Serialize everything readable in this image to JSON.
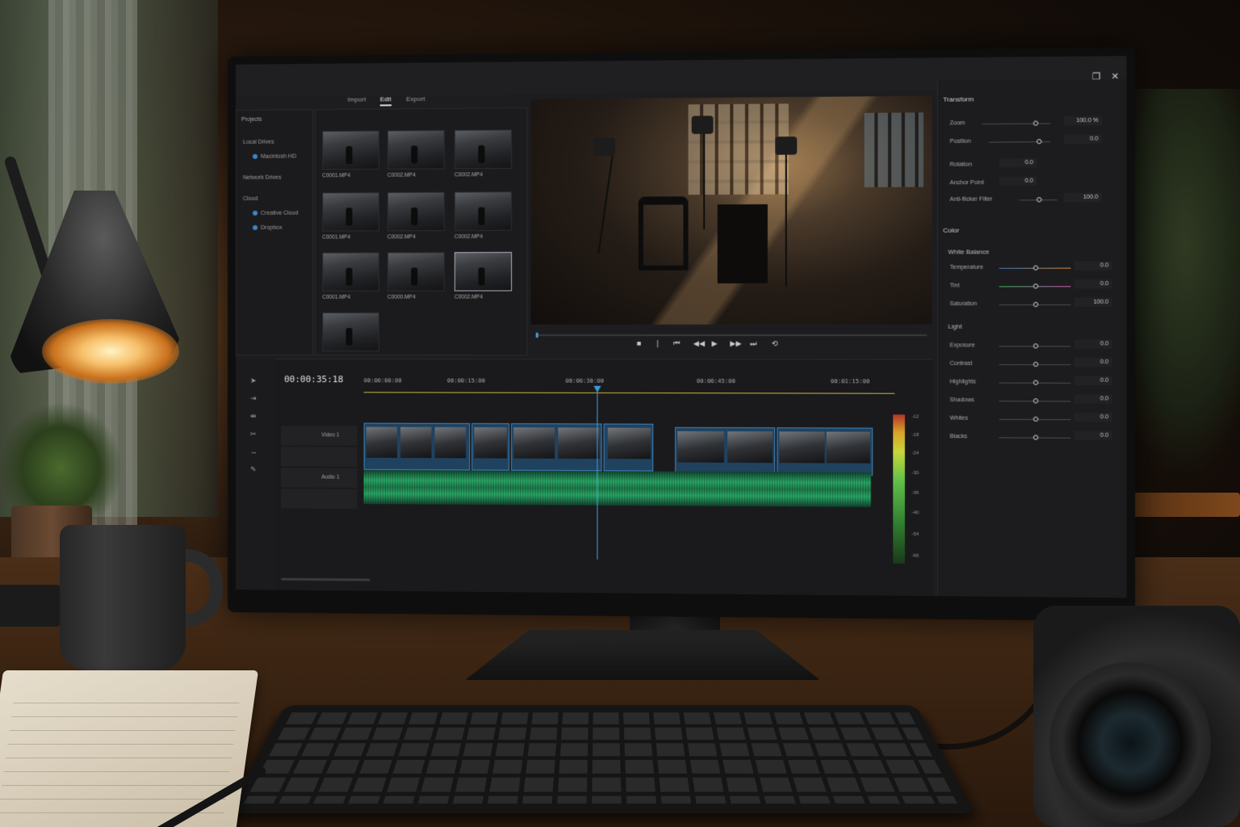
{
  "app": {
    "tabs": [
      "Import",
      "Edit",
      "Export"
    ],
    "active_tab": "Edit",
    "window_close": "✕",
    "window_restore": "❐"
  },
  "sources": {
    "title": "Projects",
    "sections": [
      {
        "label": "Local Drives",
        "items": [
          "Macintosh HD"
        ]
      },
      {
        "label": "Network Drives",
        "items": []
      },
      {
        "label": "Cloud",
        "items": [
          "Creative Cloud",
          "Dropbox"
        ]
      }
    ]
  },
  "media_bin": {
    "clips": [
      "C0001.MP4",
      "C0002.MP4",
      "C0002.MP4",
      "C0001.MP4",
      "C0002.MP4",
      "C0002.MP4",
      "C0001.MP4",
      "C0000.MP4",
      "C0002.MP4"
    ]
  },
  "timeline": {
    "timecode": "00:00:35:18",
    "ruler": [
      "00:00:00:00",
      "00:00:15:00",
      "00:00:30:00",
      "00:00:45:00",
      "00:01:15:00"
    ],
    "tracks": {
      "video": "Video 1",
      "audio": "Audio 1"
    },
    "meter_labels": [
      "-12",
      "-18",
      "-24",
      "-30",
      "-36",
      "-40",
      "-54",
      "-66"
    ]
  },
  "inspector": {
    "transform": {
      "title": "Transform",
      "rows": [
        {
          "label": "Zoom",
          "value": "100.0 %"
        },
        {
          "label": "Position",
          "value": "0.0"
        },
        {
          "label": "Rotation",
          "value": "0.0"
        },
        {
          "label": "Anchor Point",
          "value": "0.0"
        },
        {
          "label": "Anti-flicker Filter",
          "value": "100.0"
        }
      ]
    },
    "color": {
      "title": "Color",
      "subtitle": "White Balance",
      "rows": [
        {
          "label": "Temperature",
          "value": "0.0"
        },
        {
          "label": "Tint",
          "value": "0.0"
        },
        {
          "label": "Saturation",
          "value": "100.0"
        }
      ]
    },
    "light": {
      "title": "Light",
      "rows": [
        {
          "label": "Exposure",
          "value": "0.0"
        },
        {
          "label": "Contrast",
          "value": "0.0"
        },
        {
          "label": "Highlights",
          "value": "0.0"
        },
        {
          "label": "Shadows",
          "value": "0.0"
        },
        {
          "label": "Whites",
          "value": "0.0"
        },
        {
          "label": "Blacks",
          "value": "0.0"
        }
      ]
    }
  },
  "colors": {
    "accent": "#3a9ae0",
    "audio": "#2aaa68"
  }
}
